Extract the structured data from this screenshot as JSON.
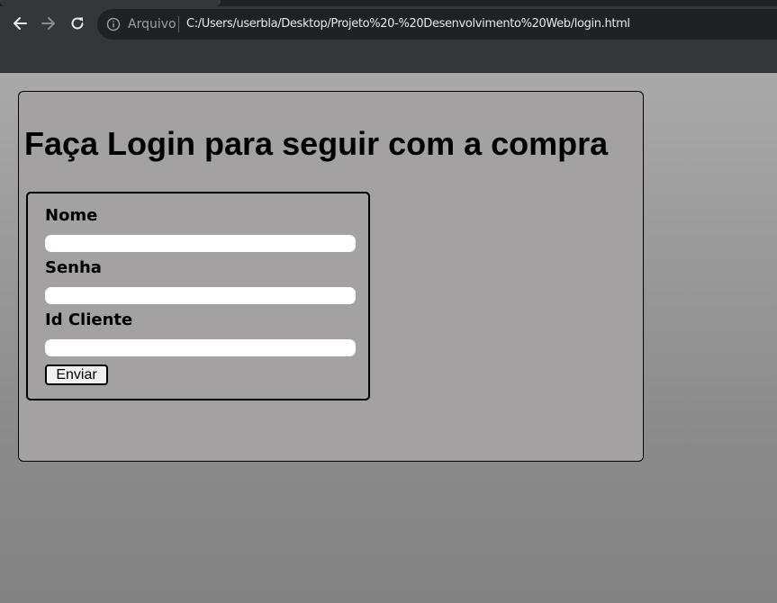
{
  "browser": {
    "nav": {
      "back_icon": "arrow-left-icon",
      "forward_icon": "arrow-right-icon",
      "reload_icon": "reload-icon"
    },
    "omnibox": {
      "security_icon": "info-icon",
      "security_label": "Arquivo",
      "url": "C:/Users/userbla/Desktop/Projeto%20-%20Desenvolvimento%20Web/login.html"
    }
  },
  "page": {
    "title": "Faça Login para seguir com a compra",
    "form": {
      "fields": [
        {
          "label": "Nome",
          "value": ""
        },
        {
          "label": "Senha",
          "value": ""
        },
        {
          "label": "Id Cliente",
          "value": ""
        }
      ],
      "submit_label": "Enviar"
    }
  },
  "colors": {
    "chrome_bg": "#35363a",
    "omnibox_bg": "#202124",
    "login_box_bg": "#a3a1a1",
    "page_bg": "#808080"
  }
}
